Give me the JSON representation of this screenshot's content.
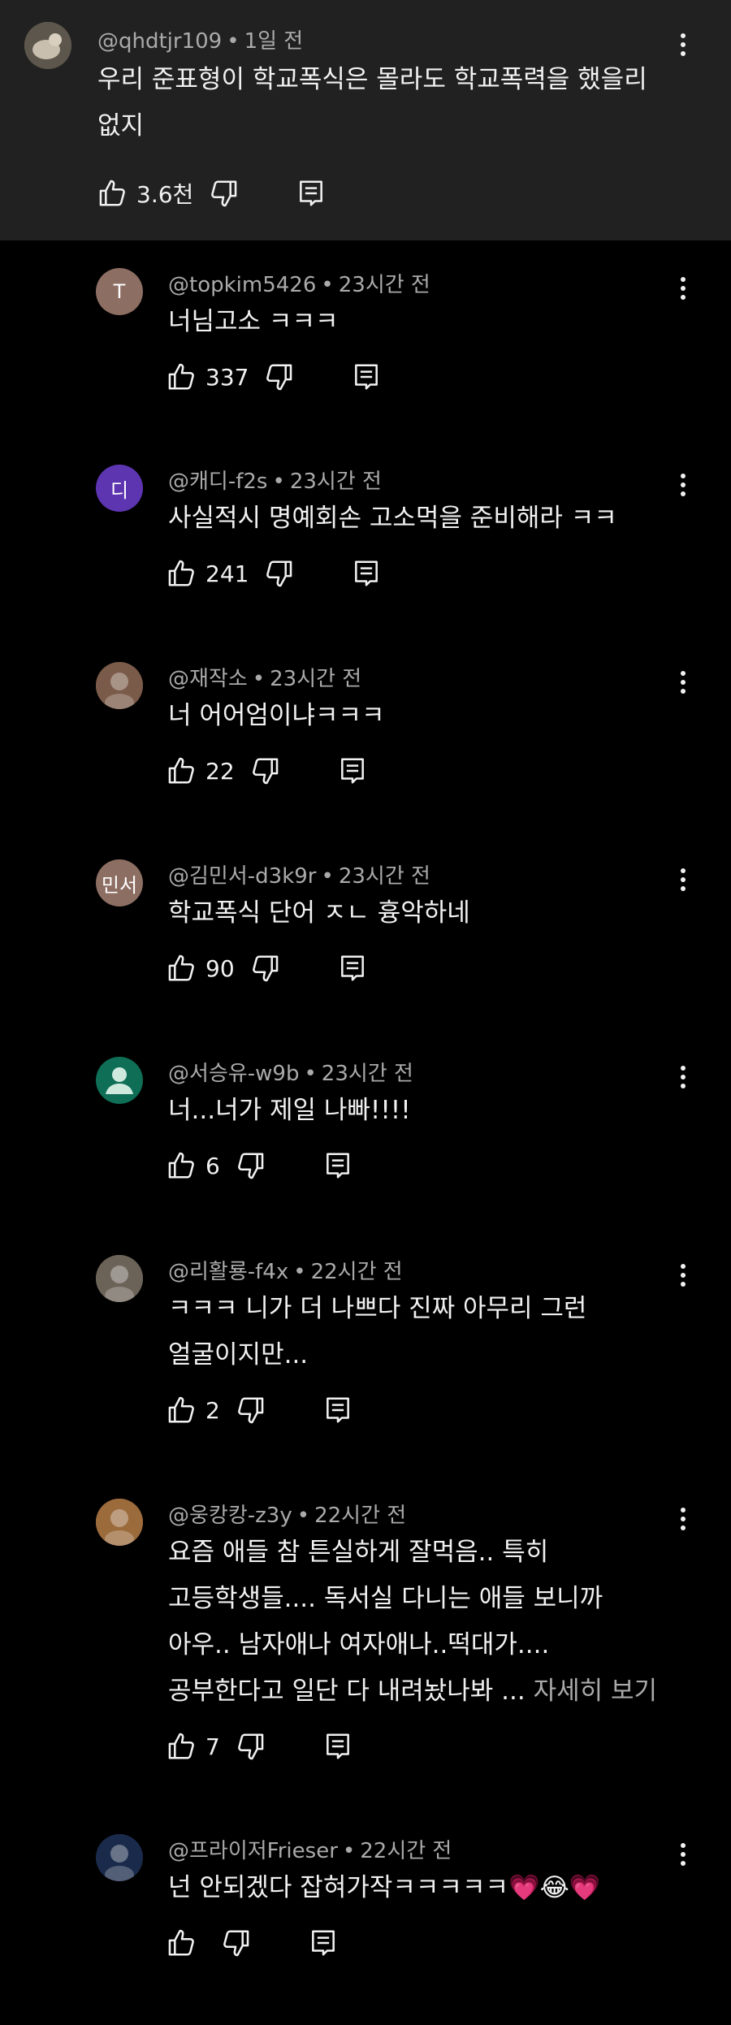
{
  "top_comment": {
    "handle": "@qhdtjr109",
    "time": "1일 전",
    "lines": [
      "우리 준표형이 학교폭식은 몰라도 학교폭력을 했을리",
      "없지"
    ],
    "likes": "3.6천"
  },
  "replies": [
    {
      "handle": "@topkim5426",
      "time": "23시간 전",
      "avatar_text": "T",
      "avatar_color": "#8d6e63",
      "lines": [
        "너님고소 ㅋㅋㅋ"
      ],
      "likes": "337"
    },
    {
      "handle": "@캐디-f2s",
      "time": "23시간 전",
      "avatar_text": "디",
      "avatar_color": "#5e35b1",
      "lines": [
        "사실적시 명예회손 고소먹을 준비해라 ㅋㅋ"
      ],
      "likes": "241"
    },
    {
      "handle": "@재작소",
      "time": "23시간 전",
      "avatar_text": "",
      "avatar_color": "#7a5a48",
      "lines": [
        "너 어어엄이냐ㅋㅋㅋ"
      ],
      "likes": "22"
    },
    {
      "handle": "@김민서-d3k9r",
      "time": "23시간 전",
      "avatar_text": "민서",
      "avatar_color": "#8d6e63",
      "lines": [
        "학교폭식 단어 ㅈㄴ 흉악하네"
      ],
      "likes": "90"
    },
    {
      "handle": "@서승유-w9b",
      "time": "23시간 전",
      "avatar_text": "",
      "avatar_color": "#0f6e56",
      "lines": [
        "너...너가 제일 나빠!!!!"
      ],
      "likes": "6"
    },
    {
      "handle": "@리활룡-f4x",
      "time": "22시간 전",
      "avatar_text": "",
      "avatar_color": "#6b6358",
      "lines": [
        "ㅋㅋㅋ 니가 더 나쁘다 진짜 아무리 그런",
        "얼굴이지만..."
      ],
      "likes": "2"
    },
    {
      "handle": "@웅캉캉-z3y",
      "time": "22시간 전",
      "avatar_text": "",
      "avatar_color": "#9c6b3c",
      "lines": [
        "요즘 애들 참 튼실하게 잘먹음.. 특히",
        "고등학생들.... 독서실 다니는 애들 보니까",
        "아우..  남자애나 여자애나..떡대가....",
        "공부한다고 일단 다 내려놨나봐 ... "
      ],
      "more": "자세히 보기",
      "likes": "7"
    },
    {
      "handle": "@프라이저Frieser",
      "time": "22시간 전",
      "avatar_text": "",
      "avatar_color": "#1a2a4a",
      "lines": [
        "넌 안되겠다 잡혀가작ㅋㅋㅋㅋㅋ💗😂💗"
      ],
      "likes": ""
    }
  ]
}
